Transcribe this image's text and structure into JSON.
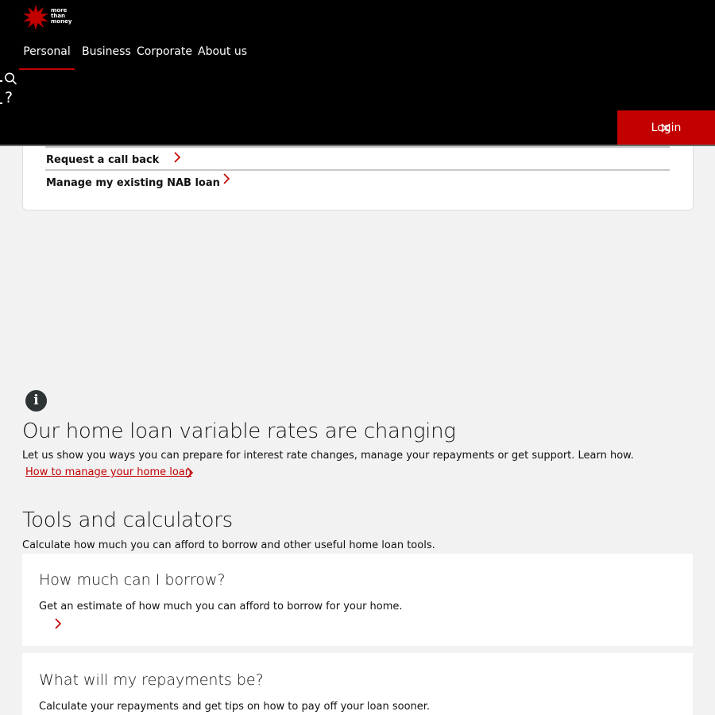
{
  "header": {
    "logo": {
      "icon": "nab-star-logo",
      "tagline": [
        "more",
        "than",
        "money"
      ],
      "color": "#c20000"
    },
    "nav": [
      {
        "label": "Personal",
        "active": true
      },
      {
        "label": "Business",
        "active": false
      },
      {
        "label": "Corporate",
        "active": false
      },
      {
        "label": "About us",
        "active": false
      }
    ],
    "icons": {
      "search": "search-icon",
      "help": "?"
    },
    "login_label": "Login",
    "close_icon": "close-icon"
  },
  "quick_links": [
    {
      "label": "Request a call back",
      "icon": "chevron-right-icon"
    },
    {
      "label": "Manage my existing NAB loan",
      "icon": "chevron-right-icon"
    }
  ],
  "rate_notice": {
    "icon": "info-icon",
    "icon_glyph": "i",
    "title": "Our home loan variable rates are changing",
    "body": "Let us show you ways you can prepare for interest rate changes, manage your repayments or get support. Learn how.",
    "link_label": "How to manage your home loan"
  },
  "tools": {
    "title": "Tools and calculators",
    "subtitle": "Calculate how much you can afford to borrow and other useful home loan tools.",
    "cards": [
      {
        "title": "How much can I borrow?",
        "description": "Get an estimate of how much you can afford to borrow for your home."
      },
      {
        "title": "What will my repayments be?",
        "description": "Calculate your repayments and get tips on how to pay off your loan sooner."
      }
    ]
  },
  "colors": {
    "brand_red": "#c20000",
    "header_bg": "#000000",
    "page_bg": "#f2f2f2"
  }
}
